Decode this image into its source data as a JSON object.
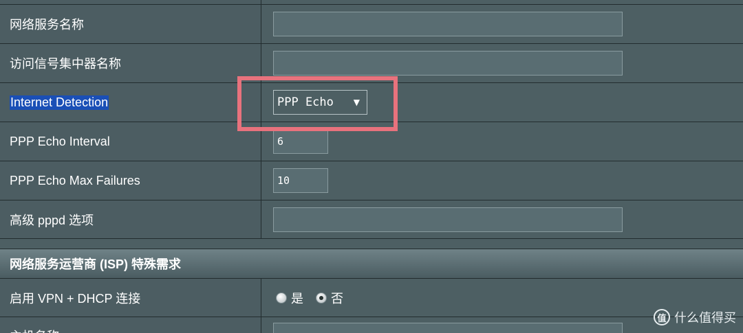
{
  "rows": {
    "service_name": {
      "label": "网络服务名称",
      "value": ""
    },
    "concentrator_name": {
      "label": "访问信号集中器名称",
      "value": ""
    },
    "internet_detection": {
      "label": "Internet Detection",
      "selected": "PPP Echo"
    },
    "echo_interval": {
      "label": "PPP Echo Interval",
      "value": "6"
    },
    "echo_max_failures": {
      "label": "PPP Echo Max Failures",
      "value": "10"
    },
    "pppd_options": {
      "label": "高级 pppd 选项",
      "value": ""
    }
  },
  "isp_section": {
    "title": "网络服务运营商 (ISP) 特殊需求",
    "vpn_dhcp": {
      "label": "启用 VPN + DHCP 连接",
      "options": [
        "是",
        "否"
      ],
      "selected": "否"
    },
    "host_name_partial": "主机名称"
  },
  "watermark": {
    "icon": "值",
    "text": "什么值得买"
  },
  "colors": {
    "highlight_box": "#e8727d",
    "selection": "#1a4fb6"
  }
}
